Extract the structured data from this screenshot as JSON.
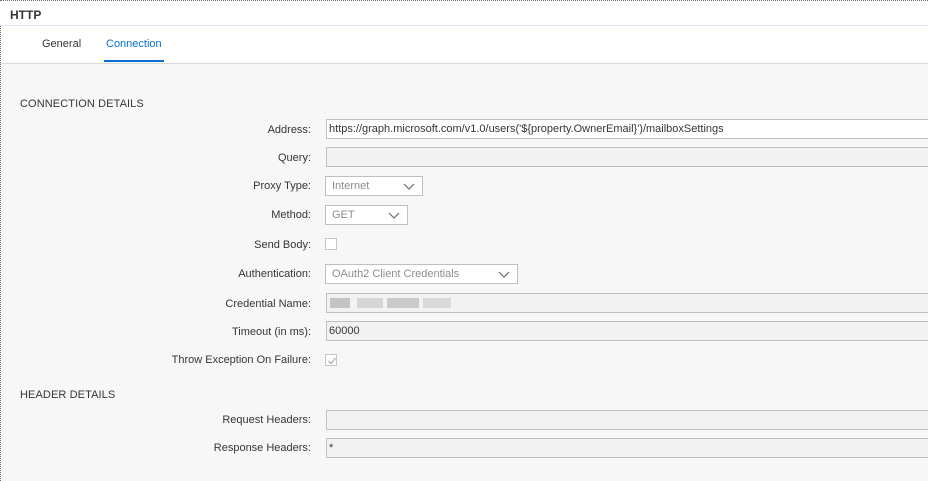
{
  "window": {
    "title": "HTTP"
  },
  "tabs": [
    {
      "label": "General",
      "active": false
    },
    {
      "label": "Connection",
      "active": true
    }
  ],
  "connection_details": {
    "heading": "CONNECTION DETAILS",
    "address": {
      "label": "Address:",
      "value": "https://graph.microsoft.com/v1.0/users('${property.OwnerEmail}')/mailboxSettings"
    },
    "query": {
      "label": "Query:",
      "value": ""
    },
    "proxy_type": {
      "label": "Proxy Type:",
      "value": "Internet"
    },
    "method": {
      "label": "Method:",
      "value": "GET"
    },
    "send_body": {
      "label": "Send Body:",
      "checked": false
    },
    "authentication": {
      "label": "Authentication:",
      "value": "OAuth2 Client Credentials"
    },
    "credential_name": {
      "label": "Credential Name:"
    },
    "timeout": {
      "label": "Timeout (in ms):",
      "value": "60000"
    },
    "throw_exception": {
      "label": "Throw Exception On Failure:",
      "checked": true
    }
  },
  "header_details": {
    "heading": "HEADER DETAILS",
    "request_headers": {
      "label": "Request Headers:",
      "value": ""
    },
    "response_headers": {
      "label": "Response Headers:",
      "value": "*"
    }
  },
  "icons": {
    "dropdown": "chevron-down-icon",
    "check": "checkmark-icon"
  },
  "colors": {
    "accent": "#0a6ed1",
    "text": "#32363a",
    "disabled_text": "#8c8c8c",
    "border": "#bfbfbf",
    "background": "#f7f7f7"
  }
}
